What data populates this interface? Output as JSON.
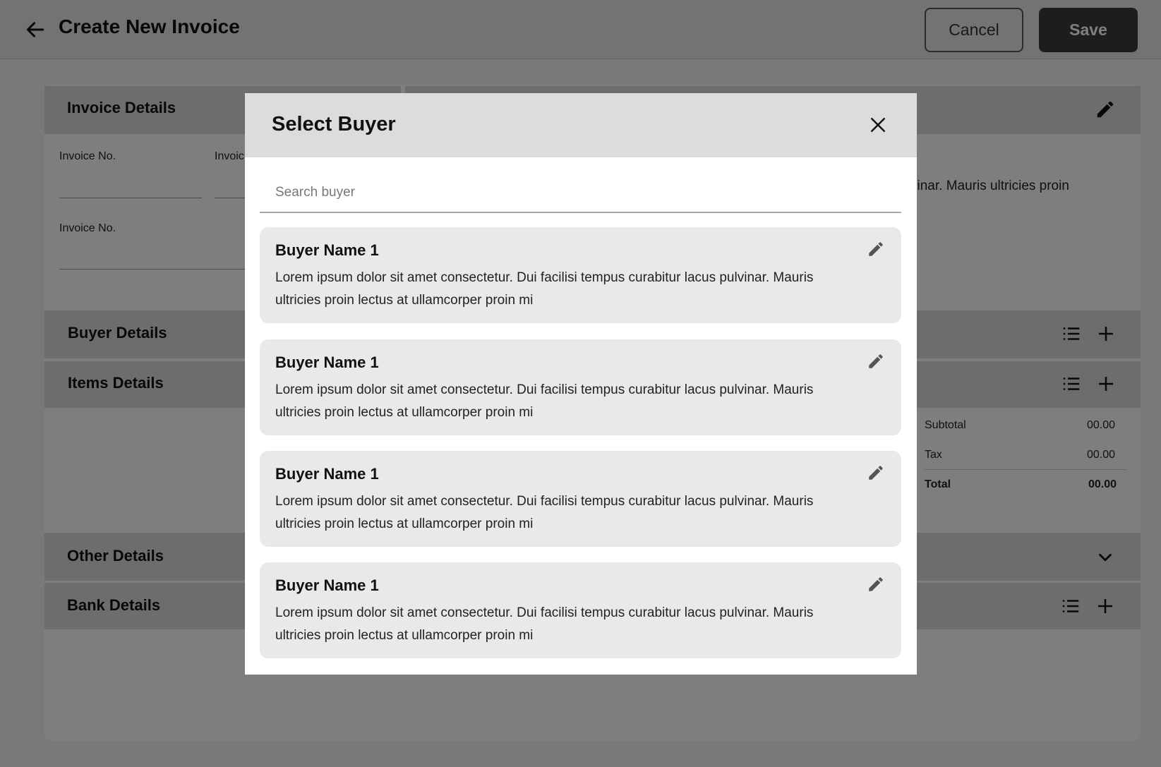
{
  "header": {
    "title": "Create New Invoice",
    "cancel_label": "Cancel",
    "save_label": "Save"
  },
  "sections": {
    "invoice_details": "Invoice Details",
    "buyer_details": "Buyer Details",
    "items_details": "Items Details",
    "other_details": "Other Details",
    "bank_details": "Bank Details"
  },
  "invoice_fields": {
    "label_1": "Invoice No.",
    "label_2": "Invoic",
    "label_3": "Invoice No."
  },
  "seller_snippet": "vinar. Mauris ultricies proin",
  "summary": {
    "subtotal_label": "Subtotal",
    "subtotal_value": "00.00",
    "tax_label": "Tax",
    "tax_value": "00.00",
    "total_label": "Total",
    "total_value": "00.00"
  },
  "modal": {
    "title": "Select Buyer",
    "search_placeholder": "Search buyer",
    "buyers": [
      {
        "name": "Buyer Name 1",
        "description": "Lorem ipsum dolor sit amet consectetur. Dui facilisi tempus curabitur lacus pulvinar. Mauris ultricies proin lectus at ullamcorper proin mi"
      },
      {
        "name": "Buyer Name 1",
        "description": "Lorem ipsum dolor sit amet consectetur. Dui facilisi tempus curabitur lacus pulvinar. Mauris ultricies proin lectus at ullamcorper proin mi"
      },
      {
        "name": "Buyer Name 1",
        "description": "Lorem ipsum dolor sit amet consectetur. Dui facilisi tempus curabitur lacus pulvinar. Mauris ultricies proin lectus at ullamcorper proin mi"
      },
      {
        "name": "Buyer Name 1",
        "description": "Lorem ipsum dolor sit amet consectetur. Dui facilisi tempus curabitur lacus pulvinar. Mauris ultricies proin lectus at ullamcorper proin mi"
      }
    ]
  },
  "icons": {
    "back": "arrow-left-icon",
    "edit": "pencil-icon",
    "list": "list-icon",
    "add": "plus-icon",
    "expand": "chevron-down-icon",
    "close": "close-icon"
  },
  "colors": {
    "overlay": "#000000",
    "save_button": "#3b3b3b",
    "section_header": "#dadada",
    "buyer_card": "#e9e9e9"
  }
}
